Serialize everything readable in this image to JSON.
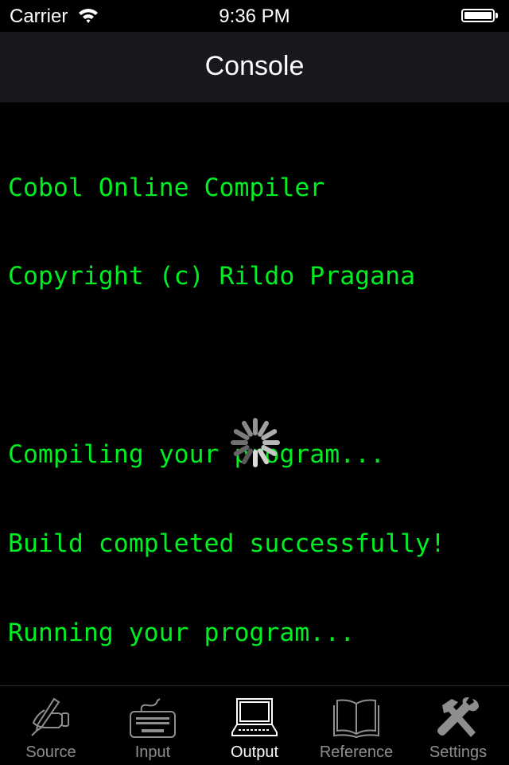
{
  "status_bar": {
    "carrier": "Carrier",
    "time": "9:36 PM",
    "wifi_icon": "wifi-icon",
    "battery_icon": "battery-full-icon",
    "battery_level": 1.0
  },
  "nav_bar": {
    "title": "Console"
  },
  "console": {
    "text_color": "#00ee22",
    "lines": [
      "Cobol Online Compiler",
      "Copyright (c) Rildo Pragana",
      "",
      "Compiling your program...",
      "Build completed successfully!",
      "Running your program..."
    ]
  },
  "activity_indicator": {
    "icon": "spinner-icon",
    "state": "running"
  },
  "tab_bar": {
    "active_color": "#ffffff",
    "inactive_color": "#8e8e8e",
    "selected": "Output",
    "tabs": [
      {
        "label": "Source",
        "icon": "hand-writing-icon"
      },
      {
        "label": "Input",
        "icon": "keyboard-icon"
      },
      {
        "label": "Output",
        "icon": "laptop-icon"
      },
      {
        "label": "Reference",
        "icon": "book-icon"
      },
      {
        "label": "Settings",
        "icon": "tools-icon"
      }
    ]
  }
}
